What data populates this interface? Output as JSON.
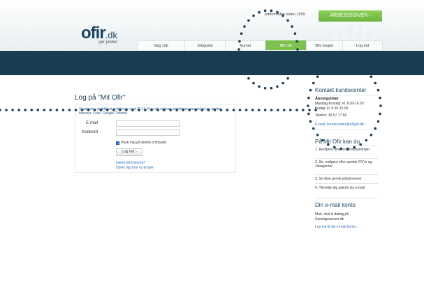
{
  "header": {
    "logo_main": "ofir",
    "logo_dk": ".dk",
    "logo_tag": "gør jobbet",
    "since_text": "Jobformidler siden 1999",
    "employer_button": "ARBEJDSGIVER ›",
    "ghost_text": "ofir"
  },
  "nav": {
    "items": [
      "Søg Job",
      "Jobguide",
      "Kurser",
      "Mit Ofir",
      "Bliv bruger",
      "Log ind"
    ],
    "active": "Mit Ofir"
  },
  "login": {
    "title": "Log på \"Mit Ofir\"",
    "notice": "Vi oplever i øjeblikket problemer med IE-11. Hvis du oplever problemer anvend da en anden browser, f.eks. Google Chrome.",
    "email_label": "E-mail",
    "password_label": "Kodeord",
    "remember_label": "Husk mig på denne computer",
    "login_button": "Log ind  ›",
    "forgot_link": "Glemt dit kodeord?",
    "create_link": "Opret dig som ny bruger"
  },
  "contact": {
    "title": "Kontakt kundecenter",
    "hours_title": "Åbningstider",
    "hours_weekdays": "Mandag-torsdag: kl. 8.30-16.30",
    "hours_friday": "fredag: kl. 8.30-15.00",
    "phone": "Telefon: 39 57 77 66",
    "email_link": "E-mail: kundecenter@ofirjob.dk ›"
  },
  "features": {
    "title": "På Mit Ofir kan du",
    "items": [
      "1. Redigere dine brugeroplysninger",
      "2. Se, redigere eller oprette CV'er og Jobagenter",
      "3. Se dine gemte jobannoncer",
      "4. Tilmelde dig jobinfo via e-mail"
    ]
  },
  "email_account": {
    "title": "Din e-mail konto",
    "text": "Mail, chat & dating på Søndagsavisen.dk",
    "link": "Log ind til din e-mail konto ›"
  },
  "colors": {
    "band": "#1b3d52",
    "accent_green": "#7cc24c",
    "dots": "#1b3d52"
  }
}
